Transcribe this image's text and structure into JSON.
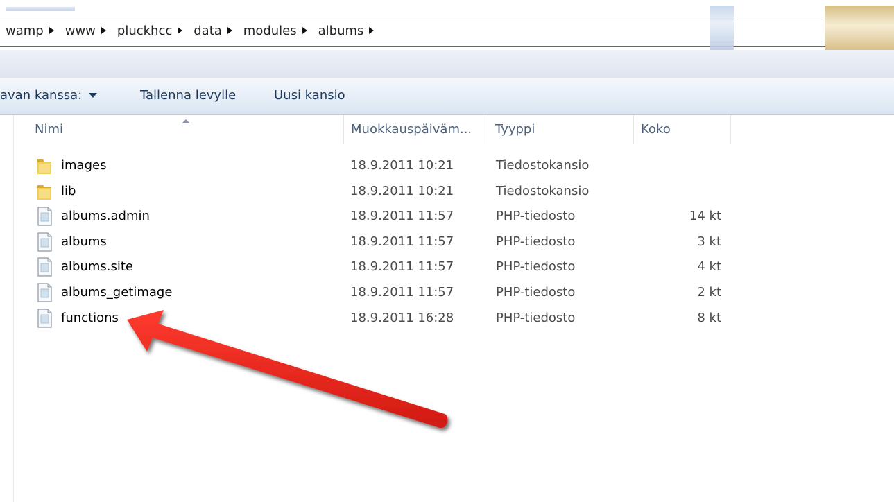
{
  "breadcrumb": [
    "wamp",
    "www",
    "pluckhcc",
    "data",
    "modules",
    "albums"
  ],
  "toolbar": {
    "share_label": "avan kanssa:",
    "burn_label": "Tallenna levylle",
    "new_folder_label": "Uusi kansio"
  },
  "columns": {
    "name": "Nimi",
    "date": "Muokkauspäiväm...",
    "type": "Tyyppi",
    "size": "Koko"
  },
  "files": [
    {
      "name": "images",
      "date": "18.9.2011 10:21",
      "type": "Tiedostokansio",
      "size": "",
      "icon": "folder-icon"
    },
    {
      "name": "lib",
      "date": "18.9.2011 10:21",
      "type": "Tiedostokansio",
      "size": "",
      "icon": "folder-icon"
    },
    {
      "name": "albums.admin",
      "date": "18.9.2011 11:57",
      "type": "PHP-tiedosto",
      "size": "14 kt",
      "icon": "php-file-icon"
    },
    {
      "name": "albums",
      "date": "18.9.2011 11:57",
      "type": "PHP-tiedosto",
      "size": "3 kt",
      "icon": "php-file-icon"
    },
    {
      "name": "albums.site",
      "date": "18.9.2011 11:57",
      "type": "PHP-tiedosto",
      "size": "4 kt",
      "icon": "php-file-icon"
    },
    {
      "name": "albums_getimage",
      "date": "18.9.2011 11:57",
      "type": "PHP-tiedosto",
      "size": "2 kt",
      "icon": "php-file-icon"
    },
    {
      "name": "functions",
      "date": "18.9.2011 16:28",
      "type": "PHP-tiedosto",
      "size": "8 kt",
      "icon": "php-file-icon"
    }
  ],
  "colors": {
    "toolbar_text": "#1e395b",
    "header_text": "#4c607a",
    "annotation_arrow": "#e8231c"
  }
}
